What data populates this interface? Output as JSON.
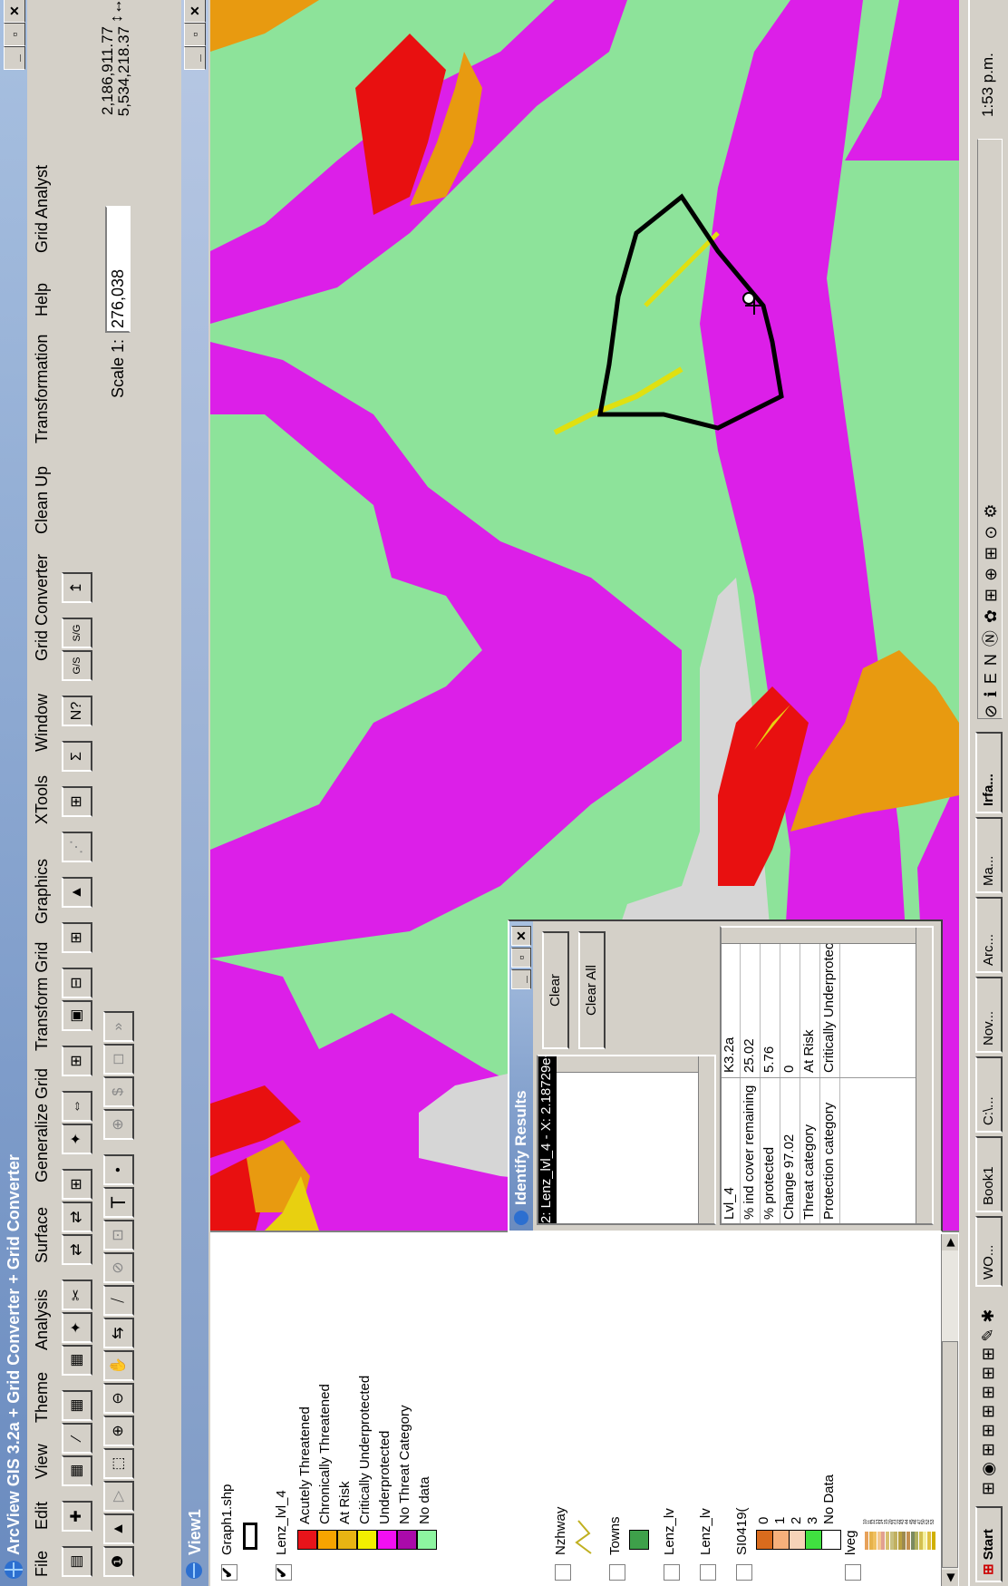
{
  "window": {
    "title": "ArcView GIS 3.2a  + Grid Converter + Grid Converter",
    "min": "_",
    "max": "▫",
    "close": "✕"
  },
  "menu": [
    "File",
    "Edit",
    "View",
    "Theme",
    "Analysis",
    "Surface",
    "Generalize Grid",
    "Transform Grid",
    "Graphics",
    "XTools",
    "Window",
    "Grid Converter",
    "Clean Up",
    "Transformation",
    "Help",
    "Grid Analyst"
  ],
  "toolbar1": [
    "▤",
    "✚",
    "▦",
    "⁄",
    "▦",
    "▦",
    "✦",
    "✂",
    "⇄",
    "⇄",
    "⊞",
    "✦",
    "⇔",
    "⊞",
    "▣",
    "⊟",
    "⊞",
    "▲",
    "⋰",
    "⊞",
    "Σ",
    "N?",
    "G/S",
    "S/G",
    "↥"
  ],
  "toolbar2": [
    "❶",
    "▲",
    "▷",
    "⬚",
    "⊕",
    "⊖",
    "✋",
    "⇆",
    "⧸",
    "⊘",
    "⊡",
    "T",
    "•",
    "⊕",
    "$",
    "◻",
    "»"
  ],
  "scale": {
    "label": "Scale 1:",
    "value": "276,038"
  },
  "coords": {
    "x": "2,186,911.77",
    "y": "5,534,218.37",
    "arrows": "↕↔"
  },
  "view": {
    "title": "View1",
    "min": "_",
    "max": "▫",
    "close": "✕"
  },
  "toc": {
    "graph": "Graph1.shp",
    "lenz_title": "Lenz_lvl_4",
    "lenz_items": [
      "Acutely Threatened",
      "Chronically Threatened",
      "At Risk",
      "Critically Underprotected",
      "Underprotected",
      "No Threat Category",
      "No data"
    ],
    "lenz_colors": [
      "#e8141a",
      "#f7a400",
      "#e7b413",
      "#f2ef00",
      "#f20ff2",
      "#aa0aaa",
      "#8df5a0",
      "#ffffff"
    ],
    "nzhway": "Nzhway",
    "towns": "Towns",
    "lenz_a": "Lenz_lv",
    "lenz_b": "Lenz_lv",
    "si": "SI0419(",
    "si_items": [
      "0",
      "1",
      "2",
      "3",
      "No Data"
    ],
    "si_colors": [
      "#d96b1d",
      "#f6b07b",
      "#f6d3b8",
      "#40e040",
      "#ffffff"
    ],
    "lveg": "lveg",
    "lveg_items": [
      "10",
      "11",
      "12",
      "13",
      "14",
      "15",
      "20",
      "21",
      "22",
      "43",
      "44",
      "45",
      "46",
      "47",
      "50",
      "52",
      "53"
    ],
    "lveg_colors": [
      "#e7a15a",
      "#e6b24a",
      "#f0c060",
      "#f4c890",
      "#e2a090",
      "#d8c070",
      "#c8c080",
      "#c0b060",
      "#b8a040",
      "#9c8a50",
      "#c49050",
      "#7a8a60",
      "#b0b060",
      "#d4c050",
      "#f4f0a0",
      "#e0c040",
      "#d0b000"
    ]
  },
  "identify": {
    "title": "Identify Results",
    "selected": "2: Lenz_lvl_4 - X: 2.18729e+006  Y: 5.5",
    "fields": [
      "Lvl_4",
      "% ind cover remaining",
      "% protected",
      "Change 97.02",
      "Threat category",
      "Protection category"
    ],
    "values": [
      "K3.2a",
      "25.02",
      "5.76",
      "0",
      "At Risk",
      "Critically Underprotected"
    ],
    "clear": "Clear",
    "clear_all": "Clear All"
  },
  "taskbar": {
    "start": "Start",
    "tasks": [
      "WO...",
      "Book1",
      "C:\\...",
      "Nov...",
      "Arc...",
      "Ma...",
      "Irfa..."
    ],
    "time": "1:53 p.m."
  },
  "colors": {
    "green": "#8de39a",
    "magenta": "#dc1fe8",
    "red": "#e81010",
    "orange": "#e89a10",
    "yellow": "#e0e010",
    "water": "#d6d6d6"
  }
}
